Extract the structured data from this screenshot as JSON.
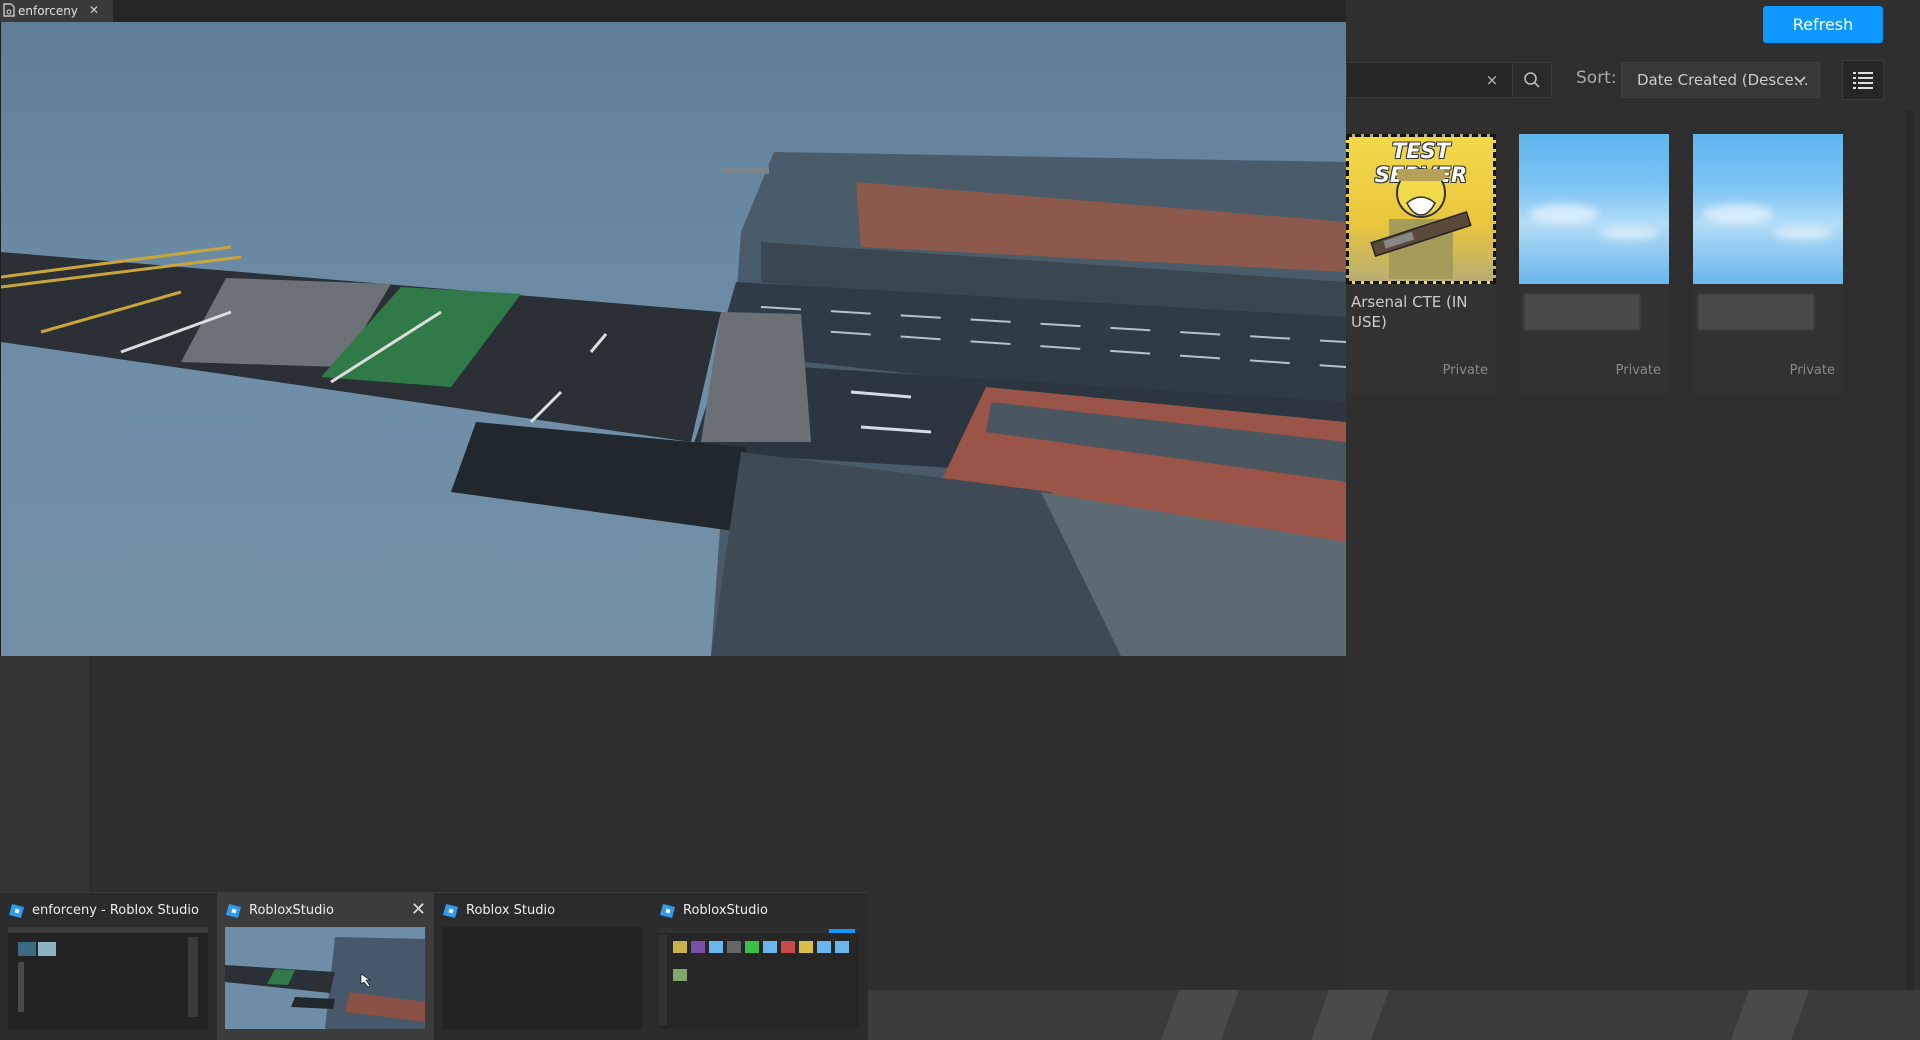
{
  "viewport_window": {
    "tab_label": "enforceny",
    "tab_icon": "document-icon",
    "tab_close": "✕"
  },
  "toolbar": {
    "refresh_label": "Refresh",
    "search_clear": "×",
    "search_icon": "search-icon",
    "sort_label": "Sort:",
    "sort_value": "Date Created (Desce…",
    "view_toggle_icon": "list-view-icon"
  },
  "games": [
    {
      "name": "Arsenal CTE (IN USE)",
      "thumb_text": "TEST SERVER",
      "privacy": "Private"
    },
    {
      "name": "",
      "privacy": "Private"
    },
    {
      "name": "",
      "privacy": "Private"
    }
  ],
  "taskbar_preview": {
    "items": [
      {
        "title": "enforceny - Roblox Studio",
        "active": false
      },
      {
        "title": "RobloxStudio",
        "active": true,
        "close": "✕"
      },
      {
        "title": "Roblox Studio",
        "active": false
      },
      {
        "title": "RobloxStudio",
        "active": false
      }
    ]
  },
  "colors": {
    "accent": "#0d99ff",
    "panel_bg": "#2f2f2f",
    "sky": "#6b8aa3"
  }
}
